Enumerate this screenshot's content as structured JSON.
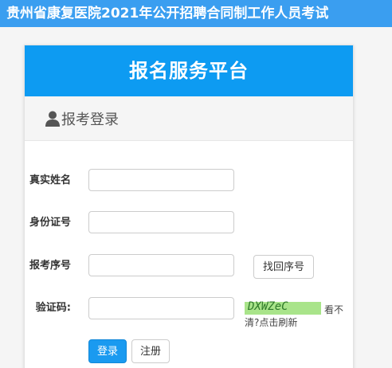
{
  "banner": {
    "title": "贵州省康复医院2021年公开招聘合同制工作人员考试"
  },
  "panel": {
    "header": "报名服务平台",
    "subheader": "报考登录"
  },
  "form": {
    "name_label": "真实姓名",
    "id_label": "身份证号",
    "seq_label": "报考序号",
    "captcha_label": "验证码:",
    "name_value": "",
    "id_value": "",
    "seq_value": "",
    "captcha_value": "",
    "find_seq_button": "找回序号",
    "captcha_image_text": "DXWZeC",
    "refresh_text_1": "看不",
    "refresh_text_2": "清?点击刷新",
    "login_button": "登录",
    "register_button": "注册"
  },
  "colors": {
    "banner": "#3a9ef0",
    "panel_header": "#0d9bf2",
    "primary_button": "#1a9af0",
    "captcha_bg": "#a9e48a"
  }
}
